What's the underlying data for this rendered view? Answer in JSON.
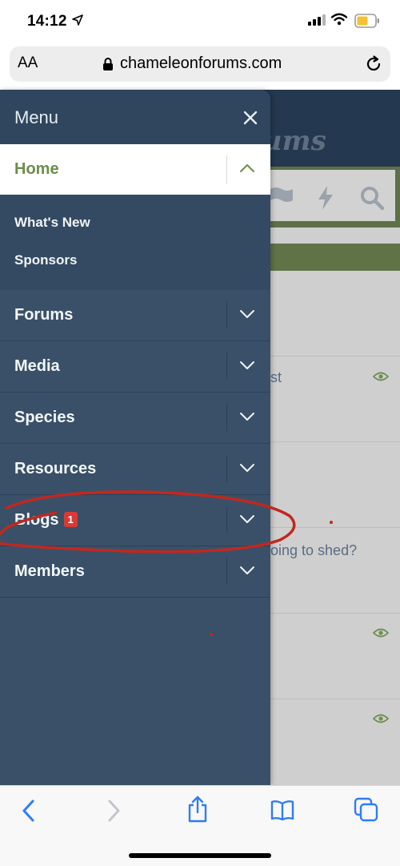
{
  "status": {
    "time": "14:12"
  },
  "browser": {
    "aa_label": "AA",
    "domain": "chameleonforums.com"
  },
  "background": {
    "logo_fragment": "rums",
    "threads": [
      {
        "text": "st",
        "has_eye": true
      },
      {
        "text": "",
        "has_eye": false
      },
      {
        "text": "oing to shed?",
        "has_eye": false
      },
      {
        "text": "",
        "has_eye": true
      },
      {
        "text": "",
        "has_eye": true
      }
    ]
  },
  "menu": {
    "title": "Menu",
    "home_label": "Home",
    "sub_items": [
      "What's New",
      "Sponsors"
    ],
    "items": [
      {
        "label": "Forums"
      },
      {
        "label": "Media"
      },
      {
        "label": "Species"
      },
      {
        "label": "Resources"
      },
      {
        "label": "Blogs",
        "badge": "1"
      },
      {
        "label": "Members"
      }
    ]
  },
  "colors": {
    "accent_green": "#6c8e4a",
    "drawer_bg": "#3a5068",
    "badge_red": "#d93a36",
    "annotation_red": "#c0281f",
    "ios_blue": "#2f7cf6"
  }
}
